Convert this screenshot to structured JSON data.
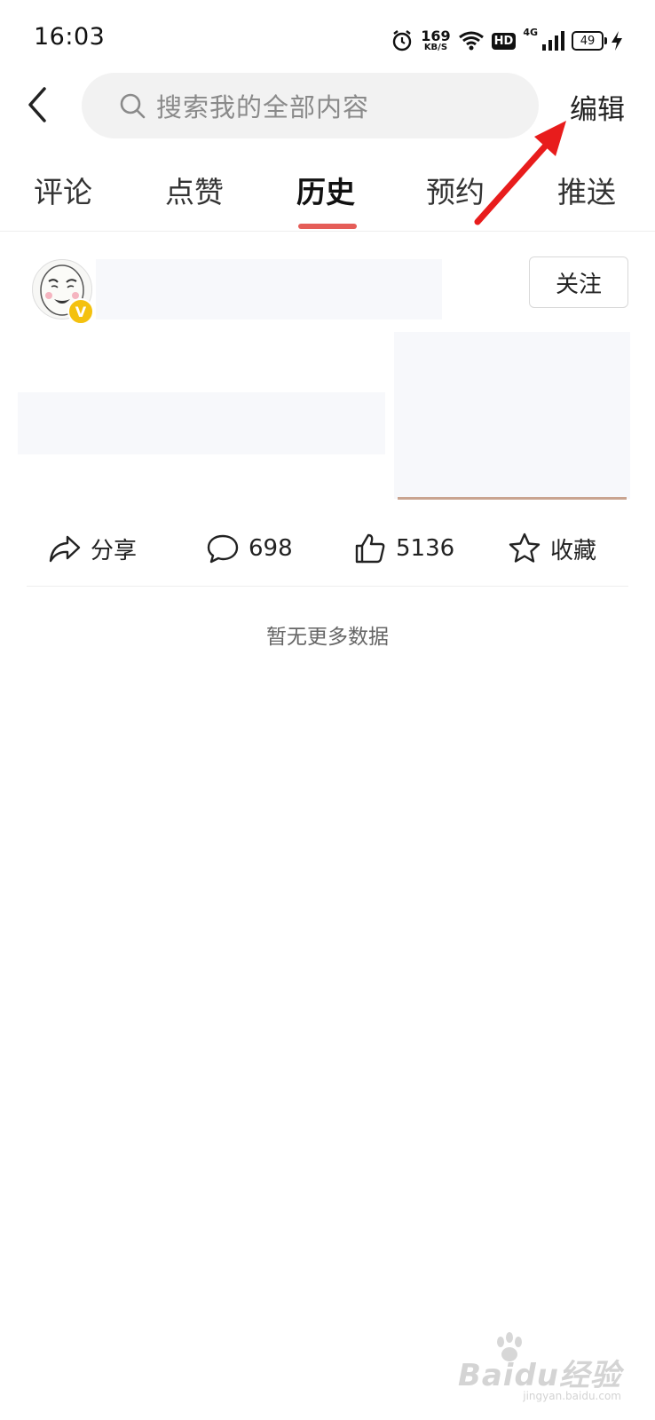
{
  "status_bar": {
    "time": "16:03",
    "net_speed_value": "169",
    "net_speed_unit": "KB/S",
    "hd_badge": "HD",
    "network_type": "4G",
    "battery_level": "49"
  },
  "header": {
    "search_placeholder": "搜索我的全部内容",
    "edit_label": "编辑"
  },
  "tabs": [
    {
      "label": "评论",
      "active": false
    },
    {
      "label": "点赞",
      "active": false
    },
    {
      "label": "历史",
      "active": true
    },
    {
      "label": "预约",
      "active": false
    },
    {
      "label": "推送",
      "active": false
    }
  ],
  "colors": {
    "accent_underline": "#e55d58",
    "annotation_arrow": "#e81c1c",
    "verified_badge": "#f4c10f"
  },
  "post": {
    "verified_mark": "V",
    "follow_label": "关注",
    "actions": {
      "share_label": "分享",
      "comments_count": "698",
      "likes_count": "5136",
      "favorite_label": "收藏"
    }
  },
  "list_end_text": "暂无更多数据",
  "watermark": {
    "brand": "Baidu经验",
    "url": "jingyan.baidu.com"
  }
}
